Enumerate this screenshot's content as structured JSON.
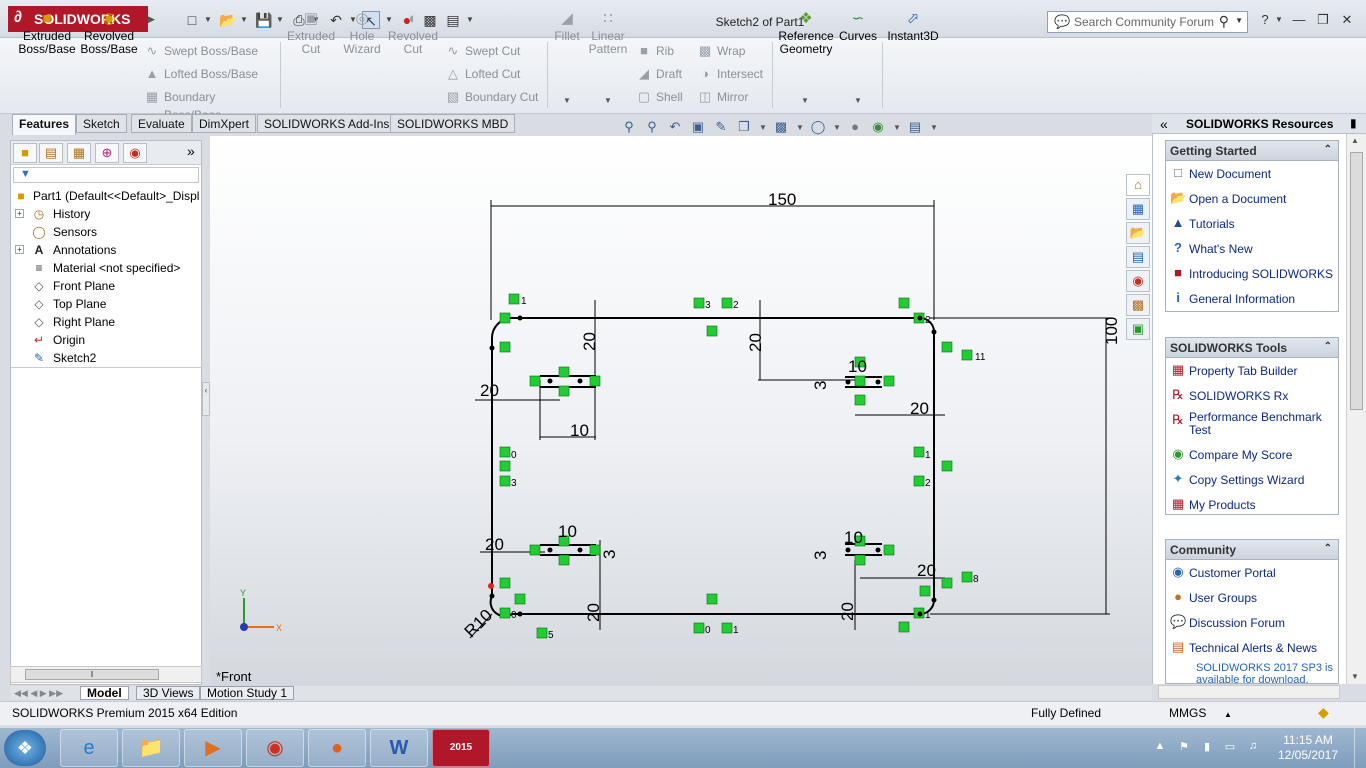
{
  "app": {
    "name": "SOLIDWORKS",
    "doc_title": "Sketch2 of Part1"
  },
  "search": {
    "placeholder": "Search Community Forum"
  },
  "commands": {
    "extruded_boss": "Extruded Boss/Base",
    "revolved_boss": "Revolved Boss/Base",
    "swept_boss": "Swept Boss/Base",
    "lofted_boss": "Lofted Boss/Base",
    "boundary_boss": "Boundary Boss/Base",
    "extruded_cut": "Extruded Cut",
    "hole_wizard": "Hole Wizard",
    "revolved_cut": "Revolved Cut",
    "swept_cut": "Swept Cut",
    "lofted_cut": "Lofted Cut",
    "boundary_cut": "Boundary Cut",
    "fillet": "Fillet",
    "linear_pattern": "Linear Pattern",
    "rib": "Rib",
    "draft": "Draft",
    "shell": "Shell",
    "wrap": "Wrap",
    "intersect": "Intersect",
    "mirror": "Mirror",
    "reference_geometry": "Reference Geometry",
    "curves": "Curves",
    "instant3d": "Instant3D"
  },
  "tabs": [
    "Features",
    "Sketch",
    "Evaluate",
    "DimXpert",
    "SOLIDWORKS Add-Ins",
    "SOLIDWORKS MBD"
  ],
  "tree": {
    "root": "Part1  (Default<<Default>_Displ",
    "items": [
      "History",
      "Sensors",
      "Annotations",
      "Material <not specified>",
      "Front Plane",
      "Top Plane",
      "Right Plane",
      "Origin",
      "Sketch2"
    ]
  },
  "sketch": {
    "dims": {
      "width": "150",
      "height": "100",
      "radius": "R10",
      "d20": "20",
      "d10": "10",
      "d3": "3",
      "r11": "11",
      "r8": "8",
      "r5": "5",
      "n0": "0",
      "n1": "1",
      "n2": "2",
      "n3": "3"
    },
    "triad": {
      "y": "Y",
      "x": "X"
    }
  },
  "view_name": "*Front",
  "bottom_tabs": [
    "Model",
    "3D Views",
    "Motion Study 1"
  ],
  "status": {
    "edition": "SOLIDWORKS Premium 2015 x64 Edition",
    "state": "Fully Defined",
    "units": "MMGS"
  },
  "taskpane": {
    "title": "SOLIDWORKS Resources",
    "getting_started": {
      "title": "Getting Started",
      "items": [
        "New Document",
        "Open a Document",
        "Tutorials",
        "What's New",
        "Introducing SOLIDWORKS",
        "General Information"
      ]
    },
    "tools": {
      "title": "SOLIDWORKS Tools",
      "items": [
        "Property Tab Builder",
        "SOLIDWORKS Rx",
        "Performance Benchmark Test",
        "Compare My Score",
        "Copy Settings Wizard",
        "My Products"
      ]
    },
    "community": {
      "title": "Community",
      "items": [
        "Customer Portal",
        "User Groups",
        "Discussion Forum",
        "Technical Alerts & News"
      ],
      "news": "SOLIDWORKS 2017 SP3 is available for download."
    }
  },
  "taskbar": {
    "time": "11:15 AM",
    "date": "12/05/2017",
    "sw_badge": "2015",
    "word_badge": "W"
  },
  "colors": {
    "brand": "#b0182a",
    "relation": "#22cc33",
    "sketch_line": "#000000",
    "link": "#0b2a7e"
  }
}
